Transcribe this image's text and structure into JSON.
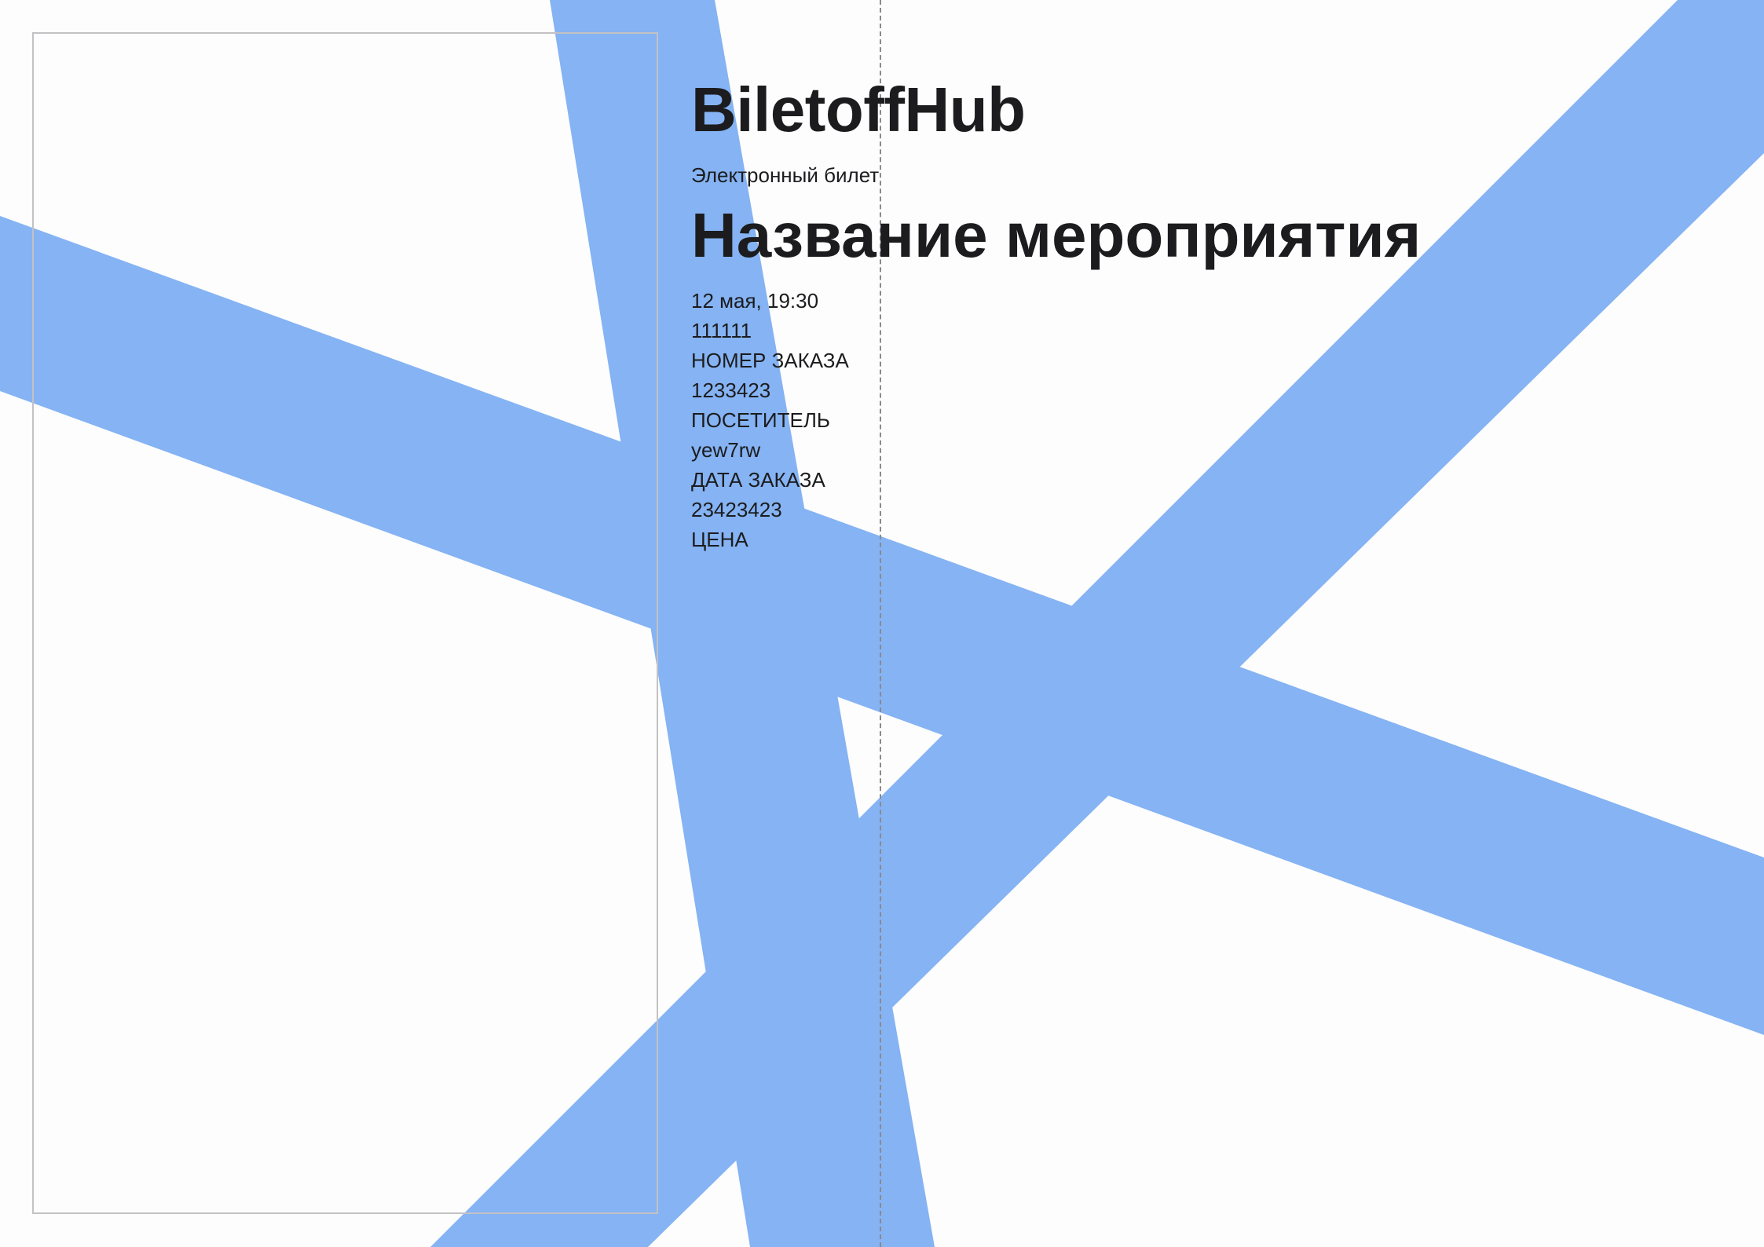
{
  "ticket": {
    "brand": "BiletoffHub",
    "subtitle": "Электронный билет",
    "event_title": "Название мероприятия",
    "event_datetime": "12 мая, 19:30",
    "code": "111111",
    "order_number_label": "НОМЕР ЗАКАЗА",
    "order_number_value": "1233423",
    "visitor_label": "ПОСЕТИТЕЛЬ",
    "visitor_value": "yew7rw",
    "order_date_label": "ДАТА ЗАКАЗА",
    "order_date_value": "23423423",
    "price_label": "ЦЕНА"
  },
  "colors": {
    "page_background": "#fdfdfe",
    "stripe_color": "#85b3f3",
    "text_color": "#1c1c1e",
    "frame_border": "#c2c2c4",
    "tear_line": "#8a8a8c"
  }
}
